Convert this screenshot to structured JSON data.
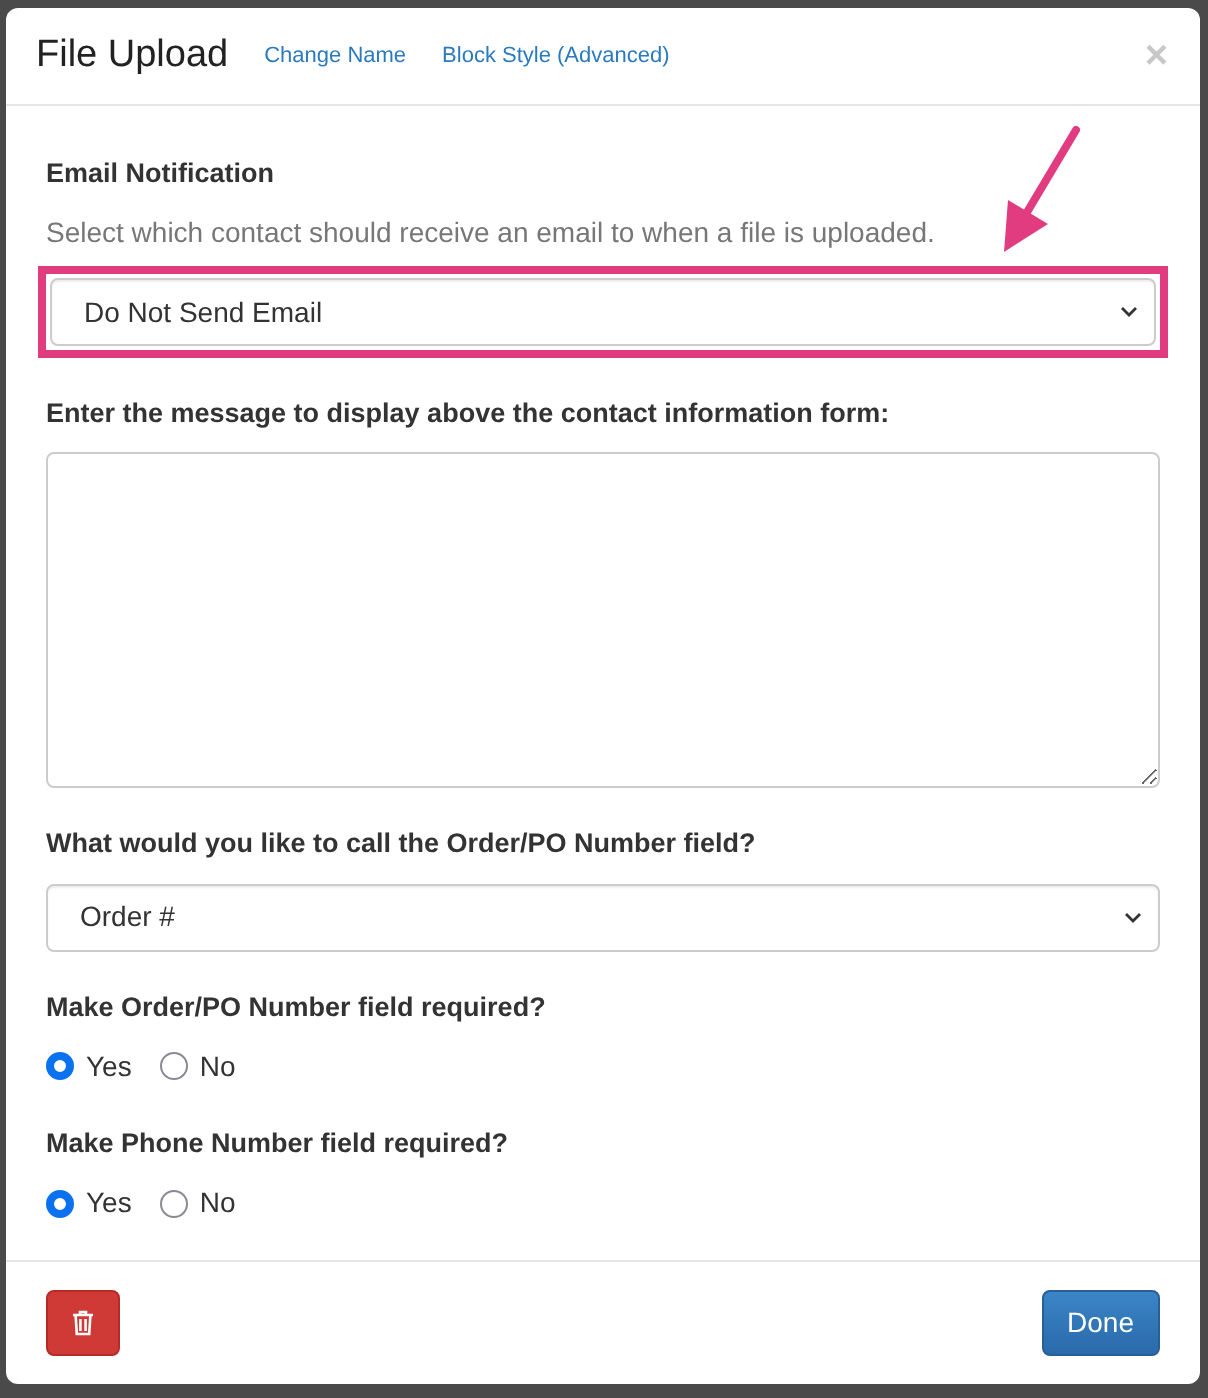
{
  "dialog": {
    "title": "File Upload",
    "header_links": [
      "Change Name",
      "Block Style (Advanced)"
    ],
    "close": "×"
  },
  "sections": [
    {
      "kind": "select",
      "label": "Email Notification",
      "help": "Select which contact should receive an email to when a file is uploaded.",
      "value": "Do Not Send Email",
      "highlighted": true
    },
    {
      "kind": "textarea",
      "label": "Enter the message to display above the contact information form:"
    },
    {
      "kind": "select",
      "label": "What would you like to call the Order/PO Number field?",
      "value": "Order #",
      "highlighted": false
    },
    {
      "kind": "radio",
      "label": "Make Order/PO Number field required?",
      "options": [
        {
          "label": "Yes",
          "selected": true
        },
        {
          "label": "No",
          "selected": false
        }
      ]
    },
    {
      "kind": "radio",
      "label": "Make Phone Number field required?",
      "options": [
        {
          "label": "Yes",
          "selected": true
        },
        {
          "label": "No",
          "selected": false
        }
      ]
    }
  ],
  "footer": {
    "done": "Done"
  }
}
